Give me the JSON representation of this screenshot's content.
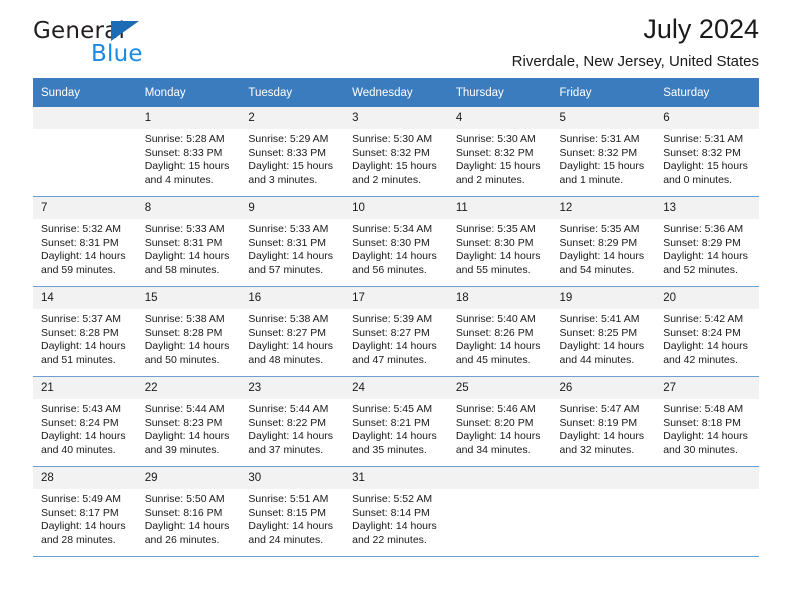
{
  "brand": {
    "word_one": "General",
    "word_two": "Blue",
    "triangle_color": "#1b6cb5",
    "blue_color": "#1b8ae0"
  },
  "header": {
    "title": "July 2024",
    "subtitle": "Riverdale, New Jersey, United States"
  },
  "calendar": {
    "header_bg": "#3a7cbe",
    "daynum_bg": "#f2f2f2",
    "row_border": "#6f9fd0",
    "weekdays": [
      "Sunday",
      "Monday",
      "Tuesday",
      "Wednesday",
      "Thursday",
      "Friday",
      "Saturday"
    ],
    "weeks": [
      [
        {
          "day": "",
          "blank": true
        },
        {
          "day": "1",
          "sunrise": "Sunrise: 5:28 AM",
          "sunset": "Sunset: 8:33 PM",
          "daylight": "Daylight: 15 hours and 4 minutes."
        },
        {
          "day": "2",
          "sunrise": "Sunrise: 5:29 AM",
          "sunset": "Sunset: 8:33 PM",
          "daylight": "Daylight: 15 hours and 3 minutes."
        },
        {
          "day": "3",
          "sunrise": "Sunrise: 5:30 AM",
          "sunset": "Sunset: 8:32 PM",
          "daylight": "Daylight: 15 hours and 2 minutes."
        },
        {
          "day": "4",
          "sunrise": "Sunrise: 5:30 AM",
          "sunset": "Sunset: 8:32 PM",
          "daylight": "Daylight: 15 hours and 2 minutes."
        },
        {
          "day": "5",
          "sunrise": "Sunrise: 5:31 AM",
          "sunset": "Sunset: 8:32 PM",
          "daylight": "Daylight: 15 hours and 1 minute."
        },
        {
          "day": "6",
          "sunrise": "Sunrise: 5:31 AM",
          "sunset": "Sunset: 8:32 PM",
          "daylight": "Daylight: 15 hours and 0 minutes."
        }
      ],
      [
        {
          "day": "7",
          "sunrise": "Sunrise: 5:32 AM",
          "sunset": "Sunset: 8:31 PM",
          "daylight": "Daylight: 14 hours and 59 minutes."
        },
        {
          "day": "8",
          "sunrise": "Sunrise: 5:33 AM",
          "sunset": "Sunset: 8:31 PM",
          "daylight": "Daylight: 14 hours and 58 minutes."
        },
        {
          "day": "9",
          "sunrise": "Sunrise: 5:33 AM",
          "sunset": "Sunset: 8:31 PM",
          "daylight": "Daylight: 14 hours and 57 minutes."
        },
        {
          "day": "10",
          "sunrise": "Sunrise: 5:34 AM",
          "sunset": "Sunset: 8:30 PM",
          "daylight": "Daylight: 14 hours and 56 minutes."
        },
        {
          "day": "11",
          "sunrise": "Sunrise: 5:35 AM",
          "sunset": "Sunset: 8:30 PM",
          "daylight": "Daylight: 14 hours and 55 minutes."
        },
        {
          "day": "12",
          "sunrise": "Sunrise: 5:35 AM",
          "sunset": "Sunset: 8:29 PM",
          "daylight": "Daylight: 14 hours and 54 minutes."
        },
        {
          "day": "13",
          "sunrise": "Sunrise: 5:36 AM",
          "sunset": "Sunset: 8:29 PM",
          "daylight": "Daylight: 14 hours and 52 minutes."
        }
      ],
      [
        {
          "day": "14",
          "sunrise": "Sunrise: 5:37 AM",
          "sunset": "Sunset: 8:28 PM",
          "daylight": "Daylight: 14 hours and 51 minutes."
        },
        {
          "day": "15",
          "sunrise": "Sunrise: 5:38 AM",
          "sunset": "Sunset: 8:28 PM",
          "daylight": "Daylight: 14 hours and 50 minutes."
        },
        {
          "day": "16",
          "sunrise": "Sunrise: 5:38 AM",
          "sunset": "Sunset: 8:27 PM",
          "daylight": "Daylight: 14 hours and 48 minutes."
        },
        {
          "day": "17",
          "sunrise": "Sunrise: 5:39 AM",
          "sunset": "Sunset: 8:27 PM",
          "daylight": "Daylight: 14 hours and 47 minutes."
        },
        {
          "day": "18",
          "sunrise": "Sunrise: 5:40 AM",
          "sunset": "Sunset: 8:26 PM",
          "daylight": "Daylight: 14 hours and 45 minutes."
        },
        {
          "day": "19",
          "sunrise": "Sunrise: 5:41 AM",
          "sunset": "Sunset: 8:25 PM",
          "daylight": "Daylight: 14 hours and 44 minutes."
        },
        {
          "day": "20",
          "sunrise": "Sunrise: 5:42 AM",
          "sunset": "Sunset: 8:24 PM",
          "daylight": "Daylight: 14 hours and 42 minutes."
        }
      ],
      [
        {
          "day": "21",
          "sunrise": "Sunrise: 5:43 AM",
          "sunset": "Sunset: 8:24 PM",
          "daylight": "Daylight: 14 hours and 40 minutes."
        },
        {
          "day": "22",
          "sunrise": "Sunrise: 5:44 AM",
          "sunset": "Sunset: 8:23 PM",
          "daylight": "Daylight: 14 hours and 39 minutes."
        },
        {
          "day": "23",
          "sunrise": "Sunrise: 5:44 AM",
          "sunset": "Sunset: 8:22 PM",
          "daylight": "Daylight: 14 hours and 37 minutes."
        },
        {
          "day": "24",
          "sunrise": "Sunrise: 5:45 AM",
          "sunset": "Sunset: 8:21 PM",
          "daylight": "Daylight: 14 hours and 35 minutes."
        },
        {
          "day": "25",
          "sunrise": "Sunrise: 5:46 AM",
          "sunset": "Sunset: 8:20 PM",
          "daylight": "Daylight: 14 hours and 34 minutes."
        },
        {
          "day": "26",
          "sunrise": "Sunrise: 5:47 AM",
          "sunset": "Sunset: 8:19 PM",
          "daylight": "Daylight: 14 hours and 32 minutes."
        },
        {
          "day": "27",
          "sunrise": "Sunrise: 5:48 AM",
          "sunset": "Sunset: 8:18 PM",
          "daylight": "Daylight: 14 hours and 30 minutes."
        }
      ],
      [
        {
          "day": "28",
          "sunrise": "Sunrise: 5:49 AM",
          "sunset": "Sunset: 8:17 PM",
          "daylight": "Daylight: 14 hours and 28 minutes."
        },
        {
          "day": "29",
          "sunrise": "Sunrise: 5:50 AM",
          "sunset": "Sunset: 8:16 PM",
          "daylight": "Daylight: 14 hours and 26 minutes."
        },
        {
          "day": "30",
          "sunrise": "Sunrise: 5:51 AM",
          "sunset": "Sunset: 8:15 PM",
          "daylight": "Daylight: 14 hours and 24 minutes."
        },
        {
          "day": "31",
          "sunrise": "Sunrise: 5:52 AM",
          "sunset": "Sunset: 8:14 PM",
          "daylight": "Daylight: 14 hours and 22 minutes."
        },
        {
          "day": "",
          "blank": true
        },
        {
          "day": "",
          "blank": true
        },
        {
          "day": "",
          "blank": true
        }
      ]
    ]
  }
}
